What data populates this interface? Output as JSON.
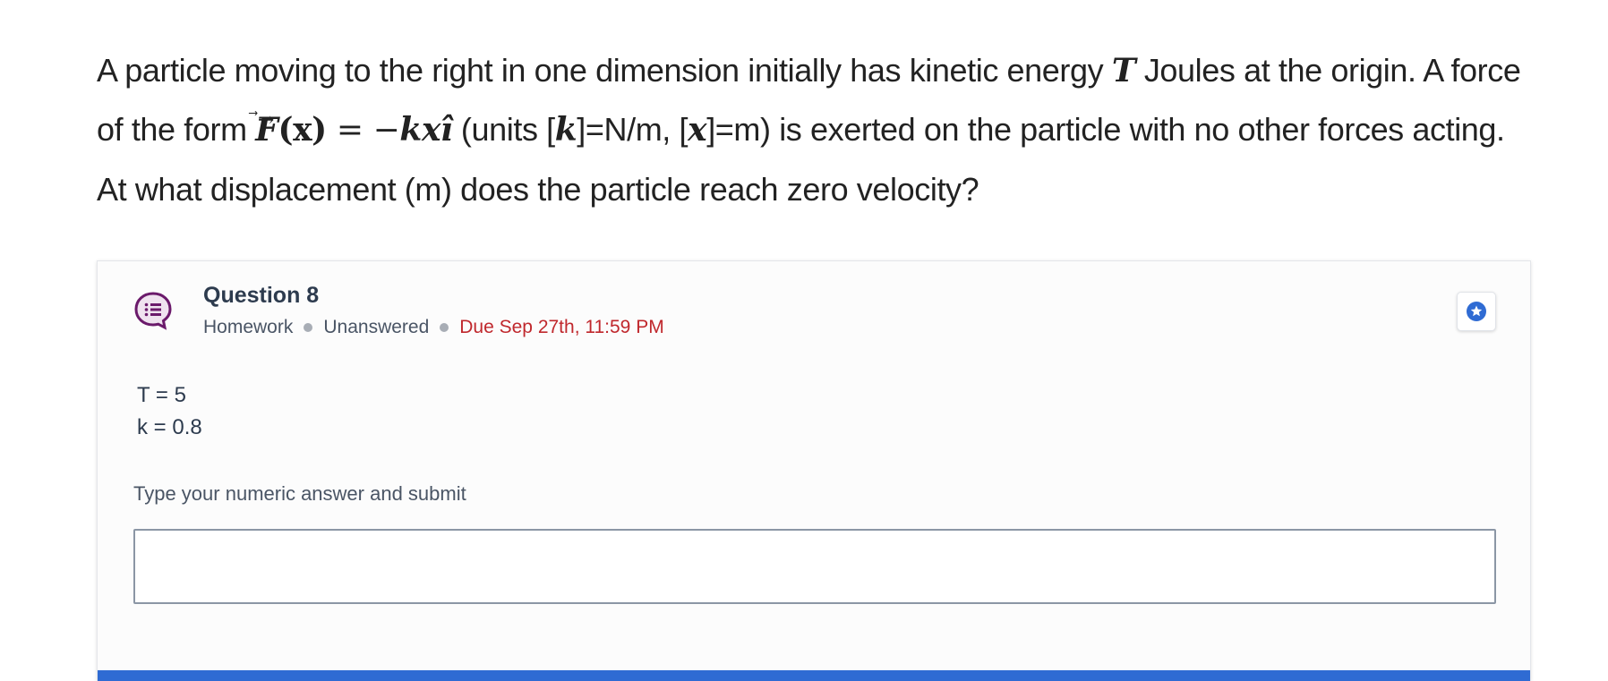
{
  "problem": {
    "part1": "A particle moving to the right in one dimension initially has kinetic energy ",
    "var_T": "T",
    "part2": " Joules at the origin.  A force of the form ",
    "force_F": "F",
    "force_arg": "(x)",
    "force_eq": " = −",
    "force_rhs": "kx",
    "force_unit_vec": "î",
    "part3": " (units [",
    "unit_k": "k",
    "part4": "]=N/m, [",
    "unit_x": "x",
    "part5": "]=m) is exerted on the particle with no other forces acting. At what displacement (m) does the particle reach zero velocity?"
  },
  "question": {
    "title": "Question 8",
    "type": "Homework",
    "status": "Unanswered",
    "due": "Due Sep 27th, 11:59 PM",
    "givens": [
      "T = 5",
      "k = 0.8"
    ],
    "answer_label": "Type your numeric answer and submit",
    "answer_value": "",
    "answer_placeholder": ""
  },
  "colors": {
    "accent": "#2f6bd3",
    "due": "#c0282d",
    "icon": "#6b1a6b"
  },
  "icons": {
    "question": "list-bubble-icon",
    "bookmark": "star-icon"
  }
}
